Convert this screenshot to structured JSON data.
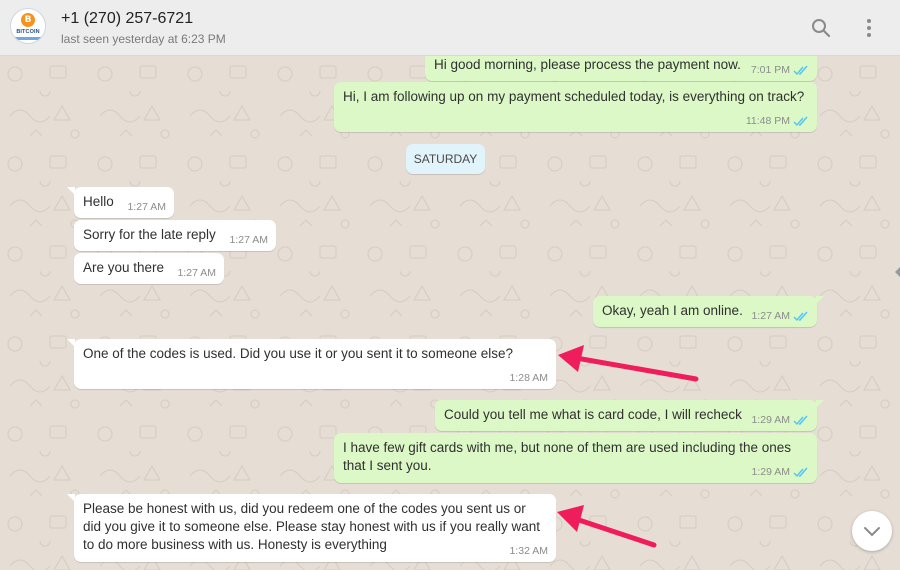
{
  "header": {
    "avatar_text": "BITCOIN",
    "contact": "+1 (270) 257-6721",
    "status": "last seen yesterday at 6:23 PM",
    "search_icon": "search-icon",
    "menu_icon": "more-vertical-icon"
  },
  "day_divider": "SATURDAY",
  "messages": [
    {
      "direction": "outgoing",
      "text": "Hi good morning, please process the payment now.",
      "time": "7:01 PM",
      "status": "read"
    },
    {
      "direction": "outgoing",
      "text": "Hi, I am following up on my payment scheduled today, is everything on track?",
      "time": "11:48 PM",
      "status": "read"
    },
    {
      "direction": "incoming",
      "text": "Hello",
      "time": "1:27 AM"
    },
    {
      "direction": "incoming",
      "text": "Sorry for the late reply",
      "time": "1:27 AM"
    },
    {
      "direction": "incoming",
      "text": "Are you there",
      "time": "1:27 AM"
    },
    {
      "direction": "outgoing",
      "text": "Okay, yeah I am online.",
      "time": "1:27 AM",
      "status": "read"
    },
    {
      "direction": "incoming",
      "text": "One of the codes is used. Did you use it or you sent it to someone else?",
      "time": "1:28 AM"
    },
    {
      "direction": "outgoing",
      "text": "Could you tell me what is card code, I will recheck",
      "time": "1:29 AM",
      "status": "read"
    },
    {
      "direction": "outgoing",
      "text": "I have few gift cards with me, but none of them are used including the ones that I sent you.",
      "time": "1:29 AM",
      "status": "read"
    },
    {
      "direction": "incoming",
      "text": "Please be honest with us, did you redeem one of the codes you sent us or did you give it to someone else. Please stay honest with us if you really want to do more business with us. Honesty is everything",
      "time": "1:32 AM"
    }
  ],
  "colors": {
    "incoming_bubble": "#ffffff",
    "outgoing_bubble": "#dcf8c6",
    "read_ticks": "#4fc3f7",
    "annotation_arrow": "#ef1d5c"
  },
  "scroll_down_icon": "chevron-down-icon"
}
